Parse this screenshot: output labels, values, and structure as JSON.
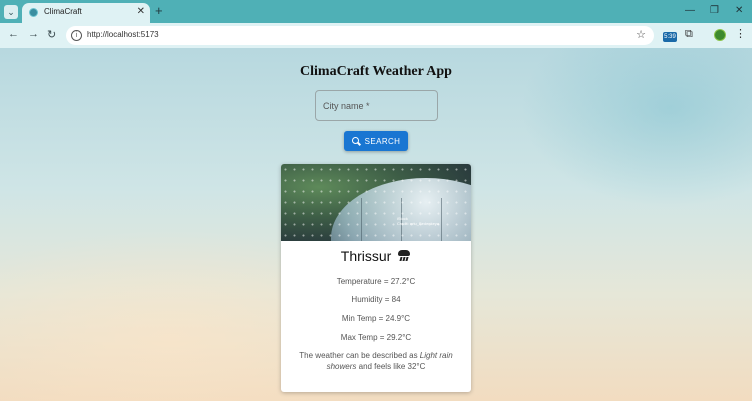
{
  "browser": {
    "tab_title": "ClimaCraft",
    "url": "http://localhost:5173",
    "extension_badge": "5:39",
    "new_tab_glyph": "+",
    "close_glyph": "✕",
    "icons": [
      "tab-search-icon",
      "back-icon",
      "forward-icon",
      "reload-icon",
      "site-info-icon",
      "bookmark-star-icon",
      "extensions-icon",
      "profile-avatar",
      "more-menu-icon",
      "minimize-icon",
      "restore-icon",
      "close-window-icon"
    ]
  },
  "app": {
    "title": "ClimaCraft Weather App",
    "search": {
      "placeholder": "City name *",
      "value": "",
      "button_label": "SEARCH"
    },
    "weather": {
      "city": "Thrissur",
      "condition_icon": "rain-cloud-icon",
      "temperature": "Temperature = 27.2°C",
      "humidity": "Humidity = 84",
      "min_temp": "Min Temp = 24.9°C",
      "max_temp": "Max Temp = 29.2°C",
      "description_prefix": "The weather can be described as ",
      "description_condition": "Light rain showers",
      "description_suffix": " and feels like 32°C"
    },
    "image_credit": "iStock\nCredit: nrtu_Bedenkeya"
  },
  "colors": {
    "tab_strip": "#4fb0b6",
    "primary_button": "#1976d2"
  }
}
